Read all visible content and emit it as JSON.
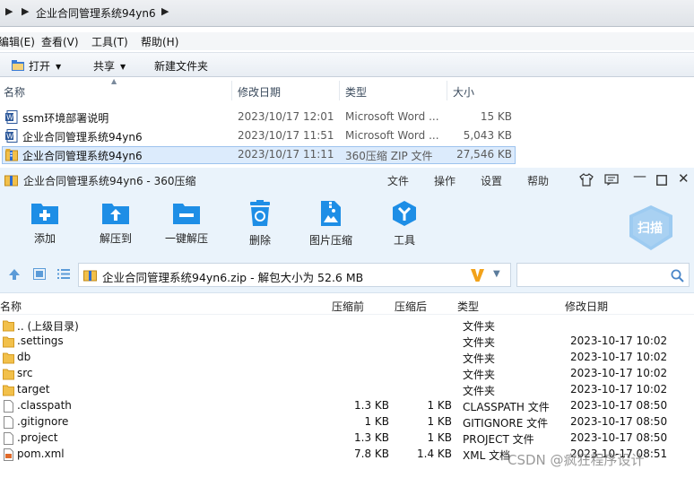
{
  "explorer": {
    "path": "企业合同管理系统94yn6",
    "menu": [
      "编辑(E)",
      "查看(V)",
      "工具(T)",
      "帮助(H)"
    ],
    "toolbar": {
      "open": "打开",
      "share": "共享",
      "new_folder": "新建文件夹"
    },
    "columns": {
      "name": "名称",
      "modified": "修改日期",
      "type": "类型",
      "size": "大小"
    },
    "files": [
      {
        "name": "ssm环境部署说明",
        "modified": "2023/10/17 12:01",
        "type": "Microsoft Word ...",
        "size": "15 KB",
        "icon": "word-doc-icon"
      },
      {
        "name": "企业合同管理系统94yn6",
        "modified": "2023/10/17 11:51",
        "type": "Microsoft Word ...",
        "size": "5,043 KB",
        "icon": "word-doc-icon"
      },
      {
        "name": "企业合同管理系统94yn6",
        "modified": "2023/10/17 11:11",
        "type": "360压缩 ZIP 文件",
        "size": "27,546 KB",
        "icon": "zip-archive-icon",
        "selected": true
      }
    ]
  },
  "zip": {
    "title": "企业合同管理系统94yn6 - 360压缩",
    "menu": [
      "文件",
      "操作",
      "设置",
      "帮助"
    ],
    "tools": [
      {
        "label": "添加",
        "icon": "add-icon"
      },
      {
        "label": "解压到",
        "icon": "extract-to-icon"
      },
      {
        "label": "一键解压",
        "icon": "one-click-extract-icon"
      },
      {
        "label": "删除",
        "icon": "delete-icon"
      },
      {
        "label": "图片压缩",
        "icon": "image-compress-icon"
      },
      {
        "label": "工具",
        "icon": "tools-icon"
      }
    ],
    "scan_label": "扫描",
    "address": "企业合同管理系统94yn6.zip - 解包大小为 52.6 MB",
    "search_placeholder": "",
    "columns": {
      "name": "名称",
      "before": "压缩前",
      "after": "压缩后",
      "type": "类型",
      "modified": "修改日期"
    },
    "rows": [
      {
        "name": ".. (上级目录)",
        "before": "",
        "after": "",
        "type": "文件夹",
        "modified": "",
        "icon": "folder-icon"
      },
      {
        "name": ".settings",
        "before": "",
        "after": "",
        "type": "文件夹",
        "modified": "2023-10-17 10:02",
        "icon": "folder-icon"
      },
      {
        "name": "db",
        "before": "",
        "after": "",
        "type": "文件夹",
        "modified": "2023-10-17 10:02",
        "icon": "folder-icon"
      },
      {
        "name": "src",
        "before": "",
        "after": "",
        "type": "文件夹",
        "modified": "2023-10-17 10:02",
        "icon": "folder-icon"
      },
      {
        "name": "target",
        "before": "",
        "after": "",
        "type": "文件夹",
        "modified": "2023-10-17 10:02",
        "icon": "folder-icon"
      },
      {
        "name": ".classpath",
        "before": "1.3 KB",
        "after": "1 KB",
        "type": "CLASSPATH 文件",
        "modified": "2023-10-17 08:50",
        "icon": "file-icon"
      },
      {
        "name": ".gitignore",
        "before": "1 KB",
        "after": "1 KB",
        "type": "GITIGNORE 文件",
        "modified": "2023-10-17 08:50",
        "icon": "file-icon"
      },
      {
        "name": ".project",
        "before": "1.3 KB",
        "after": "1 KB",
        "type": "PROJECT 文件",
        "modified": "2023-10-17 08:50",
        "icon": "file-icon"
      },
      {
        "name": "pom.xml",
        "before": "7.8 KB",
        "after": "1.4 KB",
        "type": "XML 文档",
        "modified": "2023-10-17 08:51",
        "icon": "xml-file-icon"
      }
    ]
  },
  "watermark": "CSDN @疯狂程序设计",
  "colors": {
    "accent": "#1e8ee6",
    "selection": "#dcebfc",
    "folder": "#f2c04a",
    "scan": "#8fc3ee"
  }
}
